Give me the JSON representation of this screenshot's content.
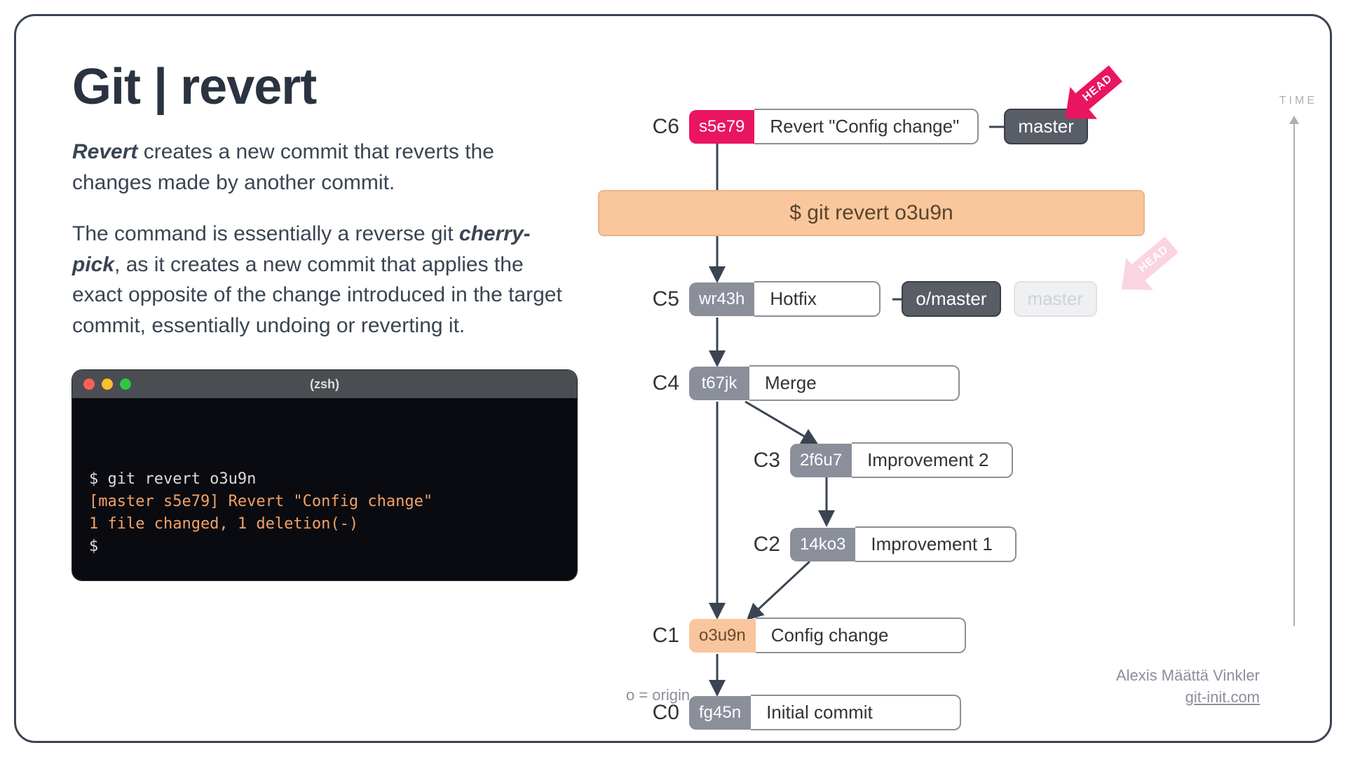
{
  "title": "Git | revert",
  "description": {
    "p1_pre": "Revert",
    "p1_rest": " creates a new commit that reverts the changes made by another commit.",
    "p2_pre": "The command is essentially a reverse git ",
    "p2_bold": "cherry-pick",
    "p2_rest": ", as it creates a new commit that applies the exact opposite of the change introduced in the target commit, essentially undoing or reverting it."
  },
  "terminal": {
    "shell": "(zsh)",
    "cmd": "$ git revert o3u9n",
    "out1": "[master s5e79] Revert \"Config change\"",
    "out2": "1 file changed, 1 deletion(-)",
    "prompt": "$"
  },
  "cmdbar": "$ git revert o3u9n",
  "commits": {
    "c6": {
      "label": "C6",
      "hash": "s5e79",
      "msg": "Revert \"Config change\""
    },
    "c5": {
      "label": "C5",
      "hash": "wr43h",
      "msg": "Hotfix"
    },
    "c4": {
      "label": "C4",
      "hash": "t67jk",
      "msg": "Merge"
    },
    "c3": {
      "label": "C3",
      "hash": "2f6u7",
      "msg": "Improvement 2"
    },
    "c2": {
      "label": "C2",
      "hash": "14ko3",
      "msg": "Improvement 1"
    },
    "c1": {
      "label": "C1",
      "hash": "o3u9n",
      "msg": "Config change"
    },
    "c0": {
      "label": "C0",
      "hash": "fg45n",
      "msg": "Initial commit"
    }
  },
  "tags": {
    "master": "master",
    "omaster": "o/master",
    "ghost_master": "master",
    "head": "HEAD"
  },
  "time_label": "TIME",
  "legend": "o = origin",
  "credit": {
    "name": "Alexis Määttä Vinkler",
    "site": "git-init.com"
  }
}
